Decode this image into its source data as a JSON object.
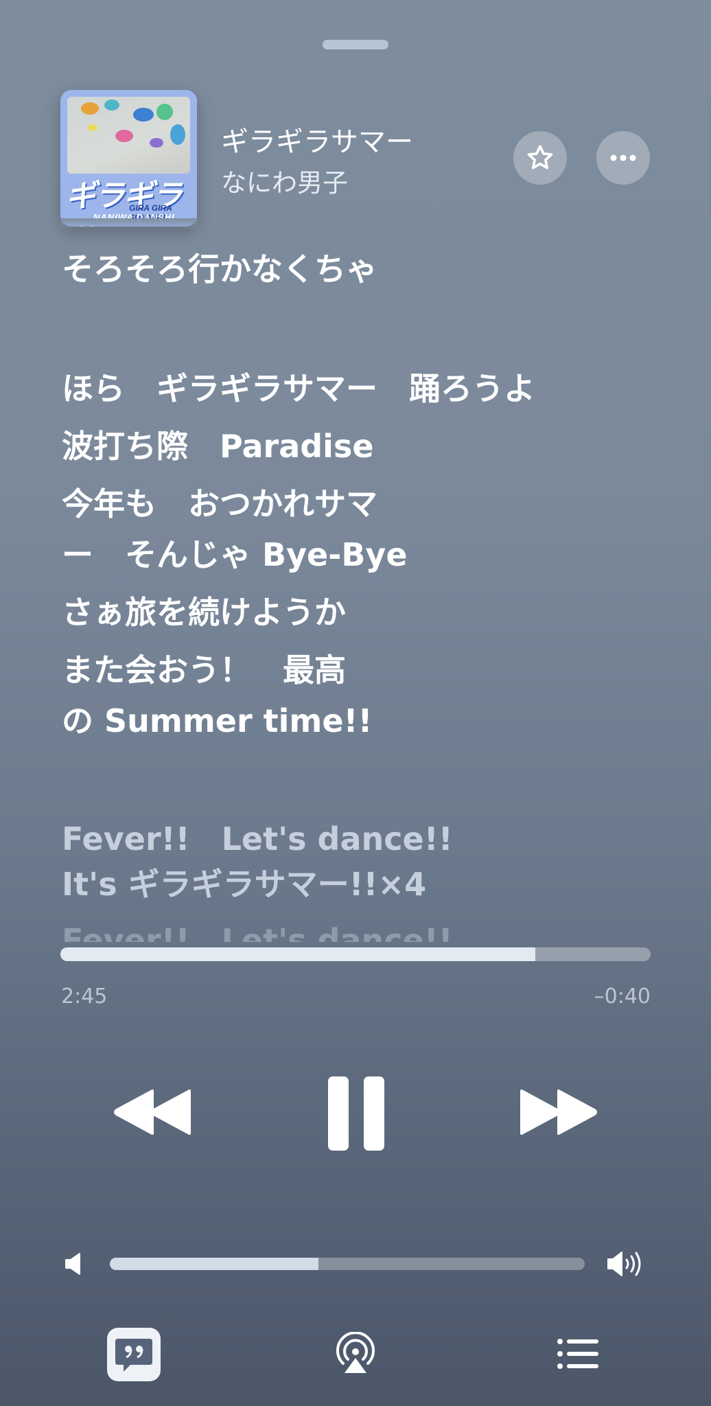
{
  "now_playing": {
    "title": "ギラギラサマー",
    "artist": "なにわ男子",
    "artwork": {
      "title_text": "ギラギラサマー",
      "subtitle_text": "GIRA GIRA SUMMER",
      "brand_text": "NANIWA DANSHI"
    }
  },
  "lyrics": [
    {
      "text": "そろそろ行かなくちゃ",
      "state": "past"
    },
    {
      "text": "ほら　ギラギラサマー　踊ろうよ",
      "state": "past"
    },
    {
      "text": "波打ち際　Paradise",
      "state": "past"
    },
    {
      "text": "今年も　おつかれサマ",
      "state": "past"
    },
    {
      "text": "ー　そんじゃ Bye-Bye",
      "state": "past"
    },
    {
      "text": "さぁ旅を続けようか",
      "state": "past"
    },
    {
      "text": "また会おう！　最高",
      "state": "past"
    },
    {
      "text": "の Summer time!!",
      "state": "past"
    },
    {
      "text": "Fever!!　Let's dance!!",
      "state": "upcoming"
    },
    {
      "text": "It's ギラギラサマー!!×4",
      "state": "upcoming"
    },
    {
      "text": "Fever!!　Let's dance!!",
      "state": "faded"
    }
  ],
  "playback": {
    "elapsed": "2:45",
    "remaining": "–0:40",
    "progress": 0.805
  },
  "volume": {
    "level": 0.44
  },
  "icons": {
    "favorite": "star-icon",
    "more": "ellipsis-icon",
    "previous": "rewind-icon",
    "pause": "pause-icon",
    "next": "fast-forward-icon",
    "volume_low": "speaker-low-icon",
    "volume_high": "speaker-high-icon",
    "lyrics": "lyrics-quote-icon",
    "airplay": "airplay-icon",
    "queue": "queue-list-icon"
  },
  "colors": {
    "background_top": "#7e8d9e",
    "background_bottom": "#4b5669",
    "progress_fill": "#e4eaf2"
  }
}
